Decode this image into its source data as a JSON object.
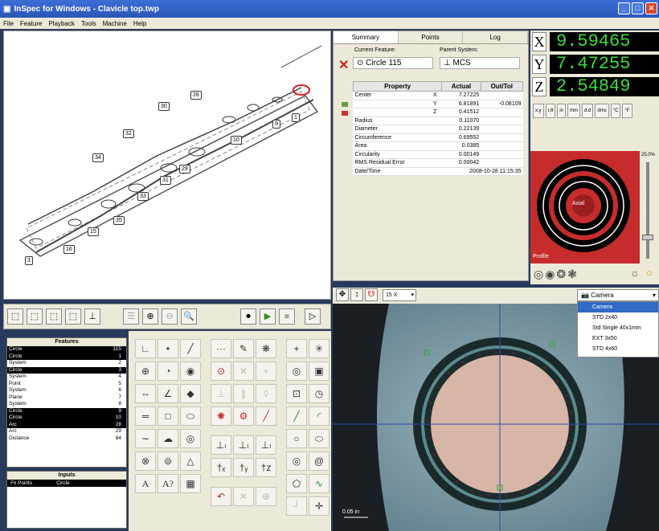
{
  "window": {
    "title": "InSpec for Windows - Clavicle top.twp"
  },
  "menu": [
    "File",
    "Feature",
    "Playback",
    "Tools",
    "Machine",
    "Help"
  ],
  "drawing": {
    "labels": [
      "30",
      "28",
      "32",
      "9",
      "1",
      "34",
      "10",
      "29",
      "31",
      "33",
      "35",
      "15",
      "16",
      "3"
    ]
  },
  "tabs": [
    "Summary",
    "Points",
    "Log"
  ],
  "current_feature": {
    "label": "Current Feature:",
    "value": "Circle 115"
  },
  "parent_system": {
    "label": "Parent System:",
    "value": "MCS"
  },
  "property_table": {
    "headers": [
      "Property",
      "Actual",
      "Out/Tol"
    ],
    "rows": [
      {
        "name": "Center",
        "axis": "X",
        "actual": "7.27225",
        "tol": ""
      },
      {
        "name": "",
        "axis": "Y",
        "actual": "6.81891",
        "tol": "-0.08109"
      },
      {
        "name": "",
        "axis": "Z",
        "actual": "0.41512",
        "tol": ""
      },
      {
        "name": "Radius",
        "axis": "",
        "actual": "0.11070",
        "tol": ""
      },
      {
        "name": "Diameter",
        "axis": "",
        "actual": "0.22139",
        "tol": ""
      },
      {
        "name": "Circumference",
        "axis": "",
        "actual": "0.69552",
        "tol": ""
      },
      {
        "name": "Area",
        "axis": "",
        "actual": "0.0385",
        "tol": ""
      },
      {
        "name": "Circularity",
        "axis": "",
        "actual": "0.00149",
        "tol": ""
      },
      {
        "name": "RMS Residual Error",
        "axis": "",
        "actual": "0.00042",
        "tol": ""
      },
      {
        "name": "Date/Time",
        "axis": "",
        "actual": "2008-10-28 11:15:35",
        "tol": ""
      }
    ]
  },
  "dro": {
    "x": {
      "axis": "X",
      "value": "9.59465"
    },
    "y": {
      "axis": "Y",
      "value": "7.47255"
    },
    "z": {
      "axis": "Z",
      "value": "2.54849"
    }
  },
  "dro_buttons": [
    "x,y",
    "r,θ",
    "in",
    "mm",
    "d.d",
    "dms",
    "°C",
    "°F"
  ],
  "light": {
    "axial": "Axial",
    "profile": "Profile",
    "zoom_pct": "25.0%"
  },
  "features": {
    "header": "Features",
    "rows": [
      {
        "name": "Circle",
        "count": "115",
        "sel": true
      },
      {
        "name": "Circle",
        "count": "1",
        "sel": true
      },
      {
        "name": "System",
        "count": "2",
        "sel": false
      },
      {
        "name": "Circle",
        "count": "3",
        "sel": true
      },
      {
        "name": "System",
        "count": "4",
        "sel": false
      },
      {
        "name": "Point",
        "count": "5",
        "sel": false
      },
      {
        "name": "System",
        "count": "6",
        "sel": false
      },
      {
        "name": "Plane",
        "count": "7",
        "sel": false
      },
      {
        "name": "System",
        "count": "8",
        "sel": false
      },
      {
        "name": "Circle",
        "count": "9",
        "sel": true
      },
      {
        "name": "Circle",
        "count": "10",
        "sel": true
      },
      {
        "name": "Arc",
        "count": "28",
        "sel": true
      },
      {
        "name": "Arc",
        "count": "29",
        "sel": false
      },
      {
        "name": "Distance",
        "count": "84",
        "sel": false
      }
    ]
  },
  "inputs": {
    "header": "Inputs",
    "fit_points": "Fit Points",
    "type": "Circle"
  },
  "camera": {
    "zoom": "15 X",
    "selected": "Camera",
    "options": [
      "Camera",
      "STD 2x40",
      "Std Single 40x1mm",
      "EXT 3x50",
      "STD 4x60"
    ],
    "scale": "0.05 in"
  },
  "colors": {
    "accent": "#316ac5",
    "dro_text": "#3ddc3d",
    "light_ring": "#c72c2c"
  }
}
